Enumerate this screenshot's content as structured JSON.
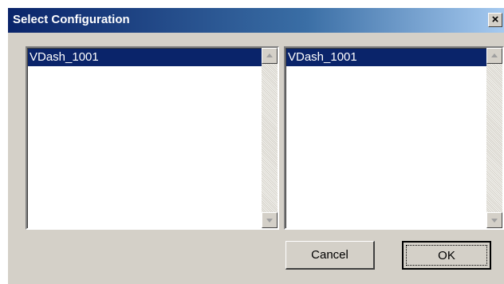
{
  "dialog": {
    "title": "Select Configuration",
    "close_symbol": "×"
  },
  "left_list": {
    "items": [
      {
        "label": "VDash_1001",
        "selected": true
      }
    ]
  },
  "right_list": {
    "items": [
      {
        "label": "VDash_1001",
        "selected": true
      }
    ]
  },
  "buttons": {
    "cancel": "Cancel",
    "ok": "OK"
  },
  "icons": {
    "close": "close-icon",
    "scroll_up": "scroll-up-arrow-icon",
    "scroll_down": "scroll-down-arrow-icon"
  },
  "colors": {
    "title_gradient_start": "#0a246a",
    "title_gradient_end": "#a6caf0",
    "dialog_face": "#d4d0c8",
    "selection": "#0a246a"
  }
}
